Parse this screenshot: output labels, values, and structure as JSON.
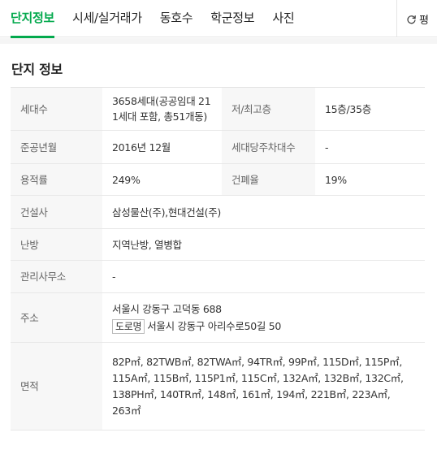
{
  "tabs": [
    {
      "label": "단지정보",
      "active": true
    },
    {
      "label": "시세/실거래가",
      "active": false
    },
    {
      "label": "동호수",
      "active": false
    },
    {
      "label": "학군정보",
      "active": false
    },
    {
      "label": "사진",
      "active": false
    }
  ],
  "unit_toggle": {
    "label": "평",
    "icon": "refresh-icon"
  },
  "section": {
    "title": "단지 정보"
  },
  "info": {
    "households": {
      "label": "세대수",
      "value_line1": "3658세대(공공임대 21",
      "value_line2": "1세대 포함, 총51개동)"
    },
    "floors": {
      "label": "저/최고층",
      "value": "15층/35층"
    },
    "completion": {
      "label": "준공년월",
      "value": "2016년 12월"
    },
    "parking": {
      "label": "세대당주차대수",
      "value": "-"
    },
    "floor_area_ratio": {
      "label": "용적률",
      "value": "249%"
    },
    "coverage_ratio": {
      "label": "건폐율",
      "value": "19%"
    },
    "builder": {
      "label": "건설사",
      "value": "삼성물산(주),현대건설(주)"
    },
    "heating": {
      "label": "난방",
      "value": "지역난방, 열병합"
    },
    "management": {
      "label": "관리사무소",
      "value": "-"
    },
    "address": {
      "label": "주소",
      "lot": "서울시 강동구 고덕동 688",
      "road_tag": "도로명",
      "road": "서울시 강동구 아리수로50길 50"
    },
    "area": {
      "label": "면적",
      "line1": "82P㎡, 82TWB㎡, 82TWA㎡, 94TR㎡, 99P㎡, 115D㎡, 115P㎡,",
      "line2": "115A㎡, 115B㎡, 115P1㎡, 115C㎡, 132A㎡, 132B㎡, 132C㎡,",
      "line3": "138PH㎡, 140TR㎡, 148㎡, 161㎡, 194㎡, 221B㎡, 223A㎡,",
      "line4": "263㎡"
    }
  },
  "colors": {
    "accent": "#03a94d",
    "label_bg": "#f7f7f7",
    "border": "#e8e8e8"
  }
}
